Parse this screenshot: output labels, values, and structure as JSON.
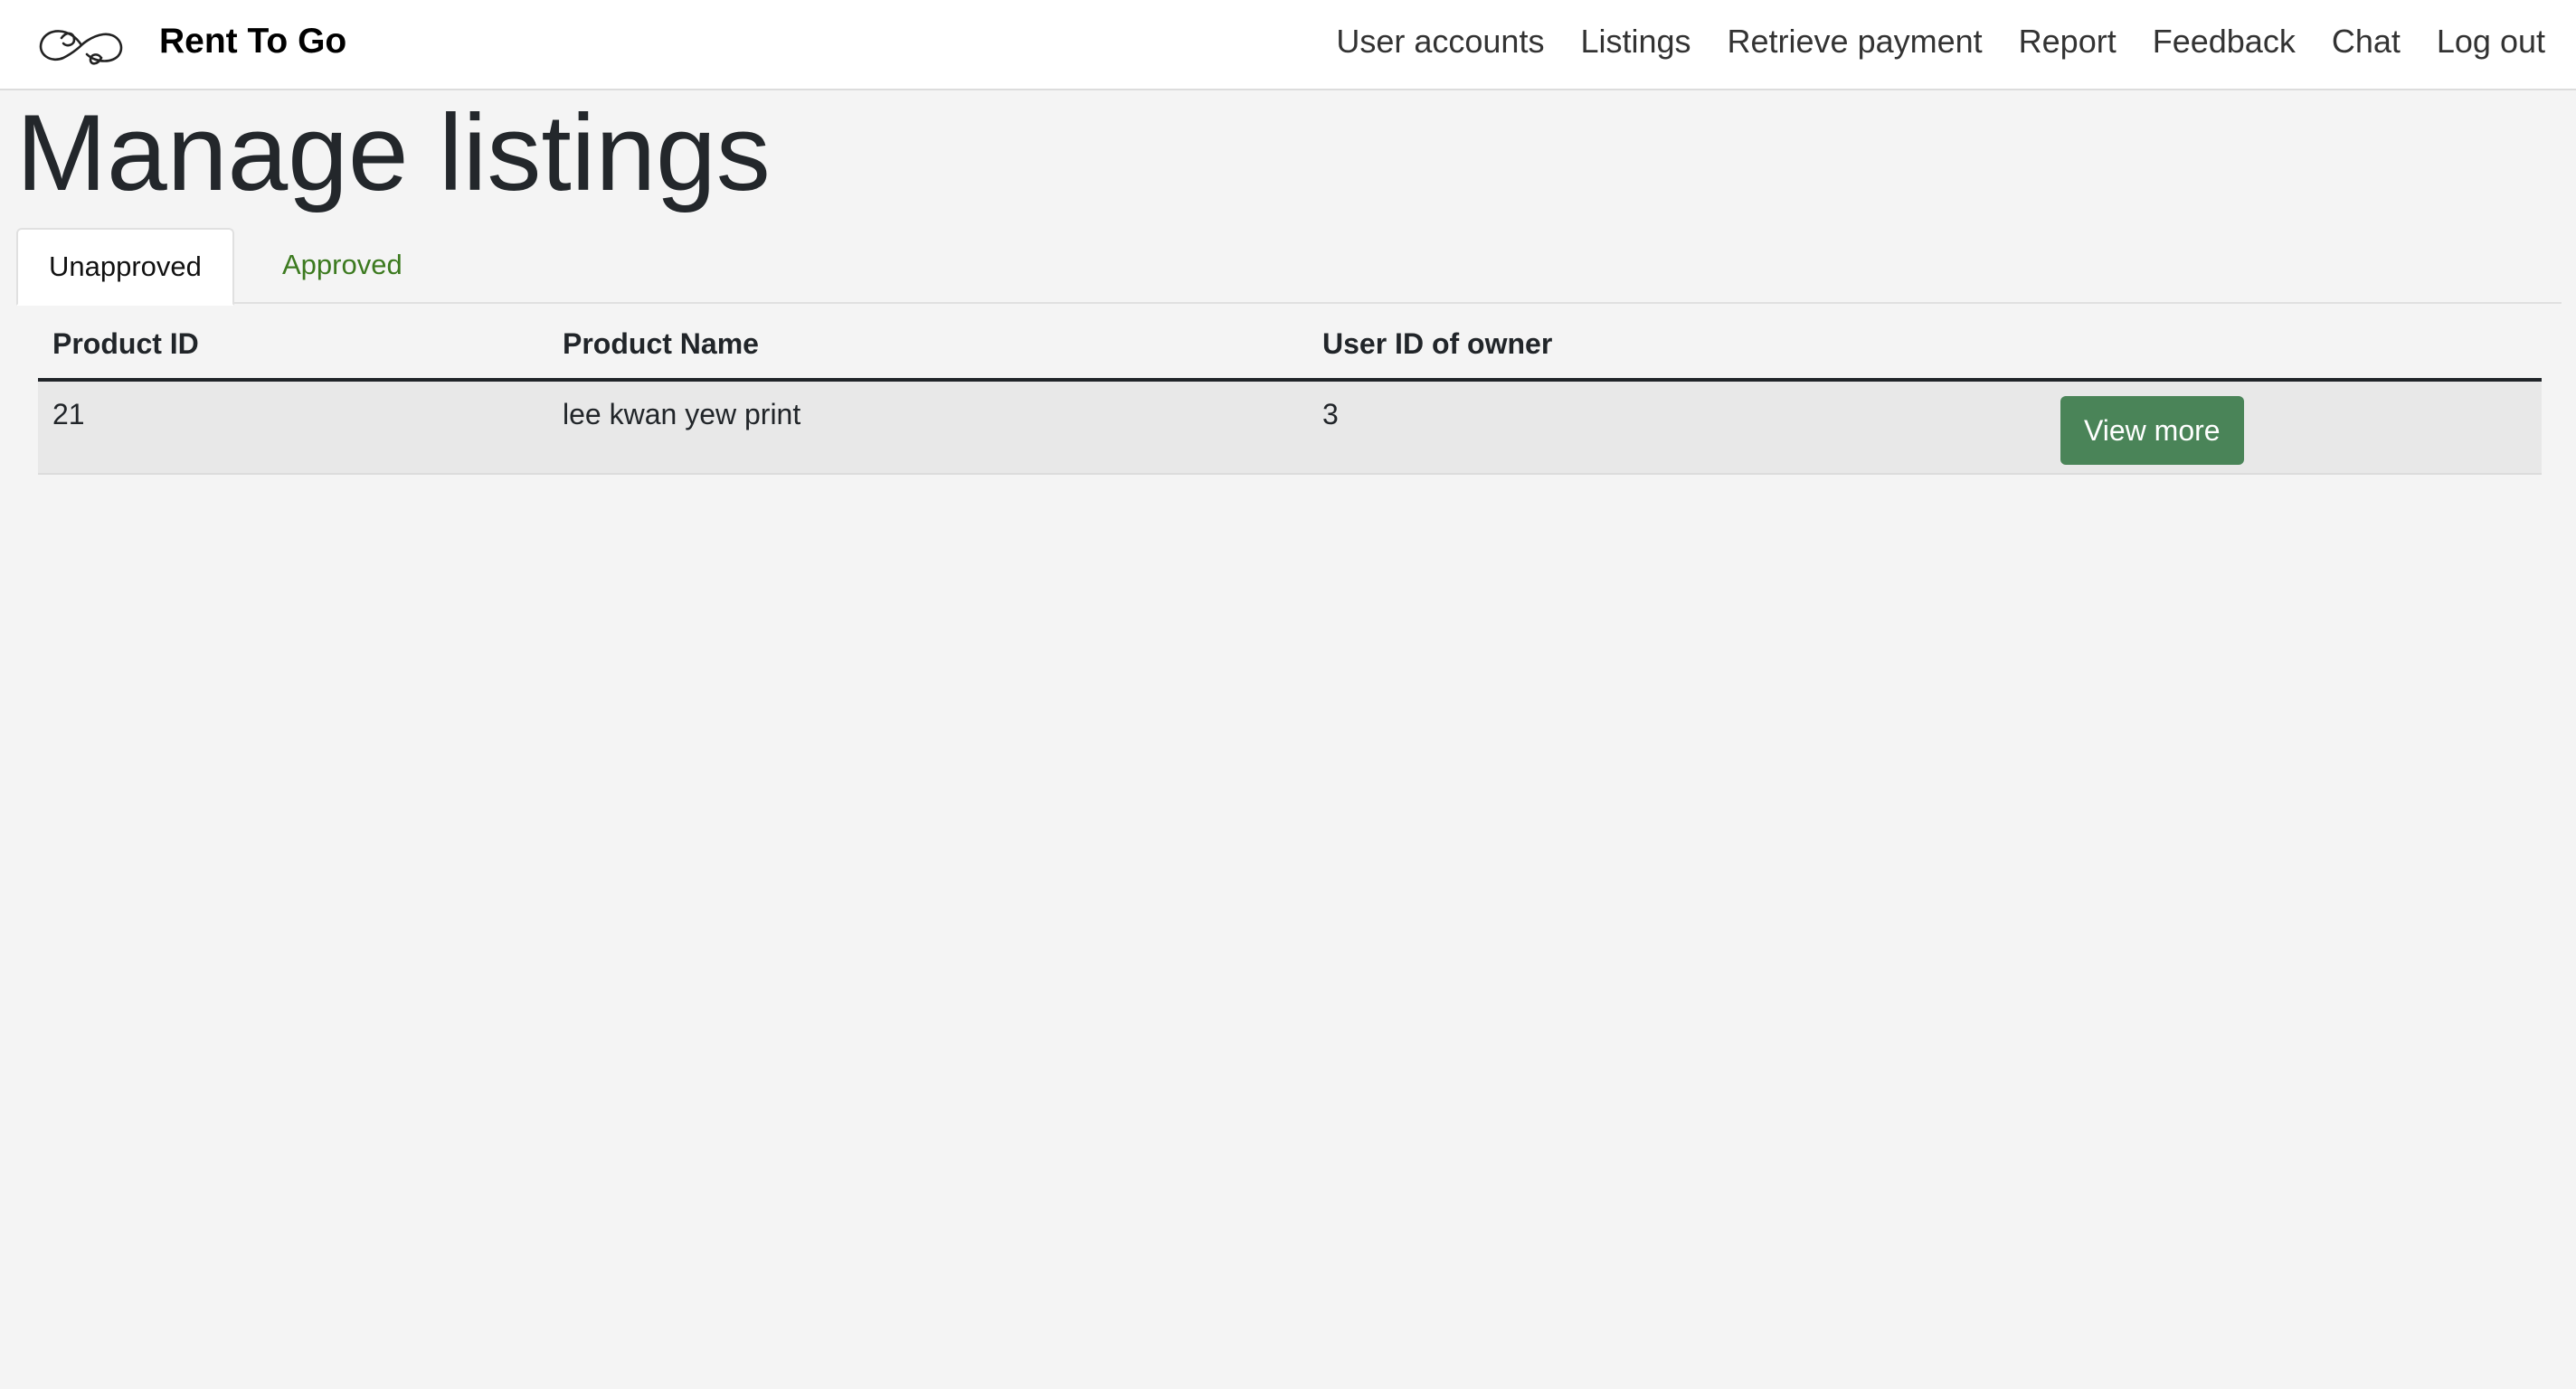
{
  "navbar": {
    "brand_name": "Rent To Go",
    "brand_logo_icon": "infinity-leaf-logo-icon",
    "links": [
      {
        "label": "User accounts"
      },
      {
        "label": "Listings"
      },
      {
        "label": "Retrieve payment"
      },
      {
        "label": "Report"
      },
      {
        "label": "Feedback"
      },
      {
        "label": "Chat"
      },
      {
        "label": "Log out"
      }
    ]
  },
  "main": {
    "title": "Manage listings",
    "tabs": [
      {
        "label": "Unapproved",
        "active": true
      },
      {
        "label": "Approved",
        "active": false
      }
    ],
    "table": {
      "headers": [
        "Product ID",
        "Product Name",
        "User ID of owner",
        ""
      ],
      "rows": [
        {
          "product_id": "21",
          "product_name": "lee kwan yew print",
          "owner_id": "3",
          "action_label": "View more"
        }
      ]
    }
  },
  "colors": {
    "background": "#f4f4f4",
    "navbar_bg": "#ffffff",
    "accent_green": "#4a8458",
    "tab_link_green": "#3c7a1f",
    "row_bg": "#e8e8e8"
  }
}
